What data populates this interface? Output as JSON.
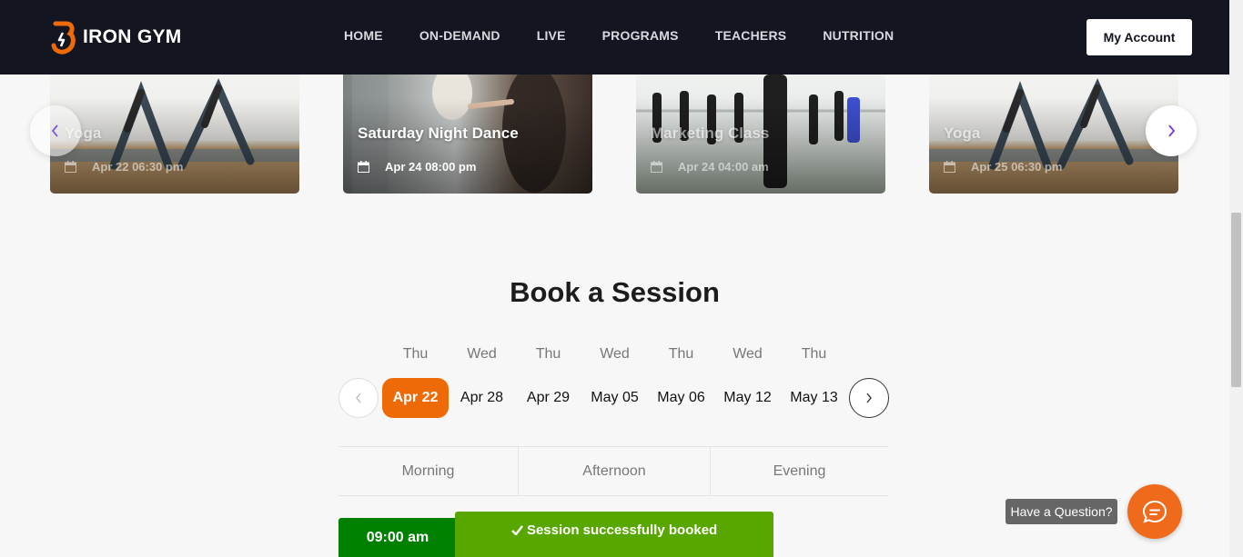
{
  "header": {
    "logo_text": "IRON GYM",
    "nav": [
      "HOME",
      "ON-DEMAND",
      "LIVE",
      "PROGRAMS",
      "TEACHERS",
      "NUTRITION"
    ],
    "account_label": "My Account"
  },
  "carousel": {
    "cards": [
      {
        "title": "Yoga",
        "date": "Apr 22 06:30 pm"
      },
      {
        "title": "Saturday Night Dance",
        "date": "Apr 24 08:00 pm"
      },
      {
        "title": "Marketing Class",
        "date": "Apr 24 04:00 am"
      },
      {
        "title": "Yoga",
        "date": "Apr 25 06:30 pm"
      }
    ]
  },
  "booking": {
    "title": "Book a Session",
    "days": [
      "Thu",
      "Wed",
      "Thu",
      "Wed",
      "Thu",
      "Wed",
      "Thu"
    ],
    "dates": [
      "Apr 22",
      "Apr 28",
      "Apr 29",
      "May 05",
      "May 06",
      "May 12",
      "May 13"
    ],
    "selected_date": "Apr 22",
    "time_tabs": [
      "Morning",
      "Afternoon",
      "Evening"
    ],
    "slot": "09:00 am"
  },
  "toast": {
    "message": "Session successfully booked"
  },
  "help": {
    "question_label": "Have a Question?"
  },
  "colors": {
    "header_bg": "#131520",
    "accent": "#ee6a06",
    "slot_green": "#008000",
    "toast_green": "#58a700"
  }
}
